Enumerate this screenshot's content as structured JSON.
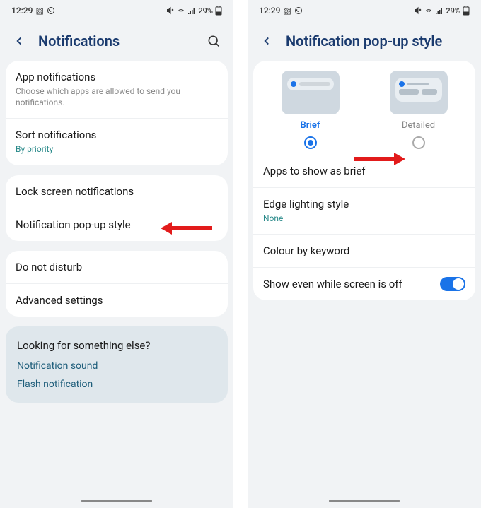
{
  "status": {
    "time": "12:29",
    "battery": "29%"
  },
  "left": {
    "title": "Notifications",
    "appNotif": {
      "title": "App notifications",
      "sub": "Choose which apps are allowed to send you notifications."
    },
    "sort": {
      "title": "Sort notifications",
      "sub": "By priority"
    },
    "lock": "Lock screen notifications",
    "popup": "Notification pop-up style",
    "dnd": "Do not disturb",
    "advanced": "Advanced settings",
    "suggest": {
      "title": "Looking for something else?",
      "link1": "Notification sound",
      "link2": "Flash notification"
    }
  },
  "right": {
    "title": "Notification pop-up style",
    "brief": "Brief",
    "detailed": "Detailed",
    "appsBrief": "Apps to show as brief",
    "edge": {
      "title": "Edge lighting style",
      "sub": "None"
    },
    "colour": "Colour by keyword",
    "showOff": "Show even while screen is off"
  }
}
